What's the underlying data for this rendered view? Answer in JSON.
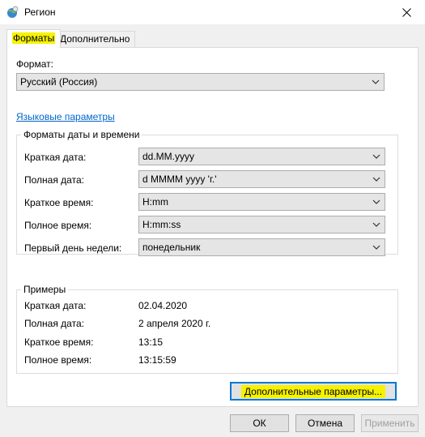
{
  "window": {
    "title": "Регион"
  },
  "tabs": [
    {
      "label": "Форматы",
      "active": true
    },
    {
      "label": "Дополнительно",
      "active": false
    }
  ],
  "format": {
    "label": "Формат:",
    "value": "Русский (Россия)"
  },
  "language_link": "Языковые параметры",
  "datetime_group": {
    "title": "Форматы даты и времени",
    "rows": [
      {
        "label": "Краткая дата:",
        "value": "dd.MM.yyyy"
      },
      {
        "label": "Полная дата:",
        "value": "d MMMM yyyy 'г.'"
      },
      {
        "label": "Краткое время:",
        "value": "H:mm"
      },
      {
        "label": "Полное время:",
        "value": "H:mm:ss"
      },
      {
        "label": "Первый день недели:",
        "value": "понедельник"
      }
    ]
  },
  "examples_group": {
    "title": "Примеры",
    "rows": [
      {
        "label": "Краткая дата:",
        "value": "02.04.2020"
      },
      {
        "label": "Полная дата:",
        "value": "2 апреля 2020 г."
      },
      {
        "label": "Краткое время:",
        "value": "13:15"
      },
      {
        "label": "Полное время:",
        "value": "13:15:59"
      }
    ]
  },
  "buttons": {
    "advanced": "Дополнительные параметры...",
    "ok": "ОК",
    "cancel": "Отмена",
    "apply": "Применить"
  },
  "colors": {
    "highlight": "#f6f200",
    "link": "#0066cc",
    "focus_border": "#0078d7"
  }
}
